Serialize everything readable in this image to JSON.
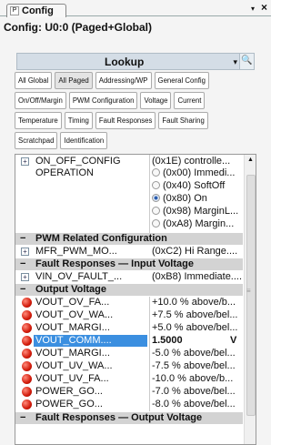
{
  "panel": {
    "tab_label": "Config",
    "tab_icon": "P",
    "close": "×",
    "pin": "▾"
  },
  "config_title": "Config: U0:0 (Paged+Global)",
  "lookup": {
    "label": "Lookup",
    "dropdown": "▾",
    "search": "🔍"
  },
  "filter_tabs": [
    [
      "All Global",
      "All Paged",
      "Addressing/WP",
      "General Config"
    ],
    [
      "On/Off/Margin",
      "PWM Configuration",
      "Voltage",
      "Current"
    ],
    [
      "Temperature",
      "Timing",
      "Fault Responses",
      "Fault Sharing"
    ],
    [
      "Scratchpad",
      "Identification"
    ]
  ],
  "selected_tab": "All Paged",
  "rows": {
    "on_off": {
      "name": "ON_OFF_CONFIG",
      "value": "(0x1E)  controlle..."
    },
    "operation": {
      "name": "OPERATION",
      "options": [
        "(0x00)  Immedi...",
        "(0x40)  SoftOff",
        "(0x80)  On",
        "(0x98)  MarginL...",
        "(0xA8)  Margin..."
      ],
      "selected": 2
    },
    "pwm_section": "PWM Related Configuration",
    "mfr_pwm": {
      "name": "MFR_PWM_MO...",
      "value": "(0xC2)  Hi Range...."
    },
    "fault_in_section": "Fault Responses  —  Input Voltage",
    "vin_ov": {
      "name": "VIN_OV_FAULT_...",
      "value": "(0xB8)  Immediate...."
    },
    "vout_section": "Output Voltage",
    "vout": [
      {
        "name": "VOUT_OV_FA...",
        "value": "+10.0 % above/b..."
      },
      {
        "name": "VOUT_OV_WA...",
        "value": "+7.5 % above/bel..."
      },
      {
        "name": "VOUT_MARGI...",
        "value": "+5.0 % above/bel..."
      },
      {
        "name": "VOUT_COMM....",
        "value": "1.5000",
        "unit": "V"
      },
      {
        "name": "VOUT_MARGI...",
        "value": "-5.0 % above/bel..."
      },
      {
        "name": "VOUT_UV_WA...",
        "value": "-7.5 % above/bel..."
      },
      {
        "name": "VOUT_UV_FA...",
        "value": "-10.0 % above/b..."
      },
      {
        "name": "POWER_GO...",
        "value": "-7.0 % above/bel..."
      },
      {
        "name": "POWER_GO...",
        "value": "-8.0 % above/bel..."
      }
    ],
    "fault_out_section": "Fault Responses  —  Output Voltage"
  }
}
